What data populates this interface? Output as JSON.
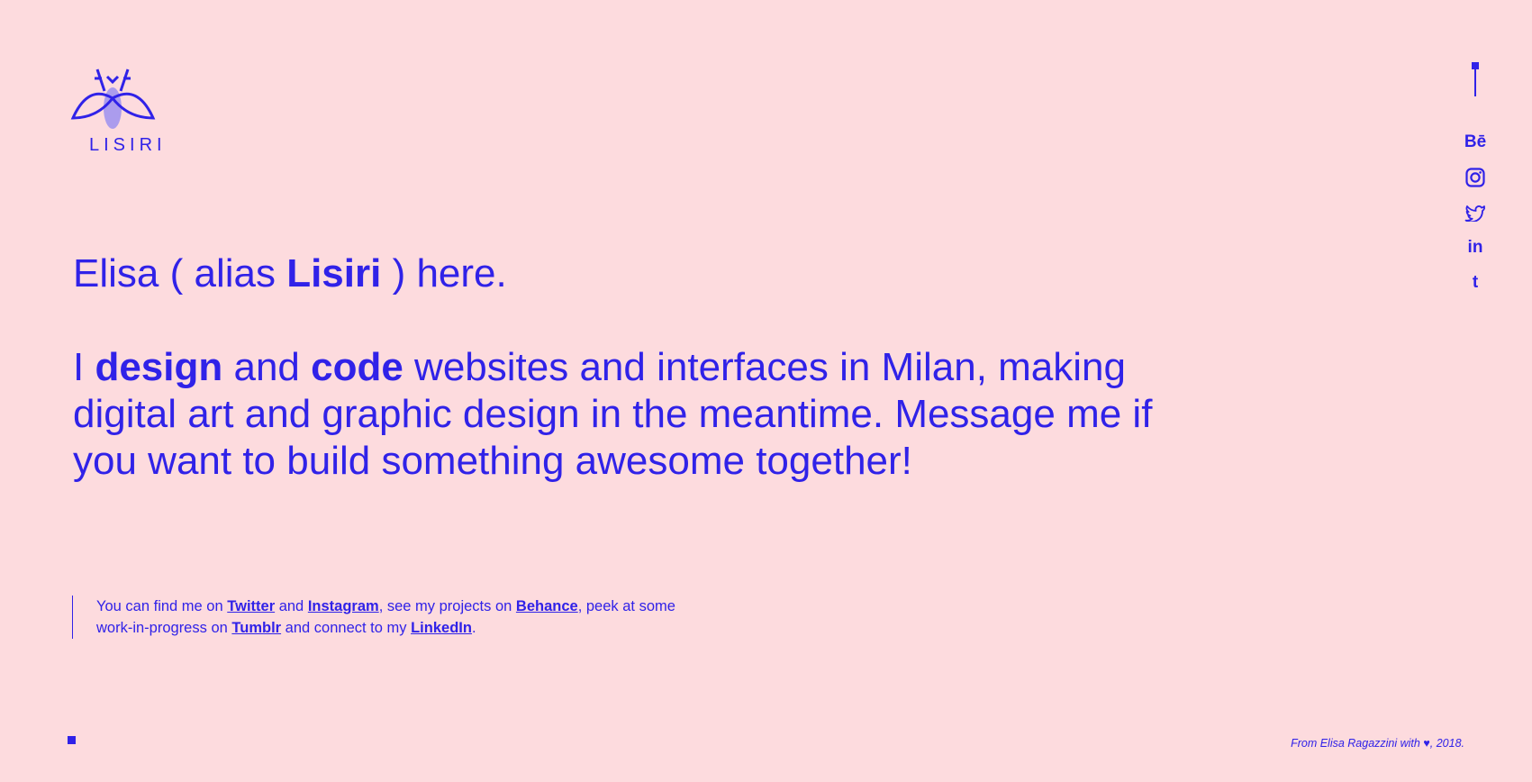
{
  "brand": {
    "name": "LISIRI"
  },
  "hero": {
    "intro": {
      "before": "Elisa ( alias ",
      "name": "Lisiri",
      "after": " ) here."
    },
    "body": {
      "w1": "I ",
      "design": "design",
      "w2": " and ",
      "code": "code",
      "w3": " websites and interfaces in Milan, making digital art and graphic design in the meantime. Message me if you want to build something awesome together!"
    }
  },
  "find": {
    "t1": "You can find me on ",
    "twitter": "Twitter",
    "t2": " and ",
    "instagram": "Instagram",
    "t3": ", see my projects on ",
    "behance": "Behance",
    "t4": ", peek at some work-in-progress on ",
    "tumblr": "Tumblr",
    "t5": " and connect to my ",
    "linkedin": "LinkedIn",
    "t6": "."
  },
  "social": {
    "behance": "Bē",
    "linkedin": "in",
    "tumblr": "t",
    "icons": [
      "behance-icon",
      "instagram-icon",
      "twitter-icon",
      "linkedin-icon",
      "tumblr-icon"
    ]
  },
  "footer": {
    "text": "From Elisa Ragazzini with",
    "heart": "♥",
    "year": ", 2018."
  },
  "colors": {
    "background": "#fddbde",
    "accent": "#3022e8"
  }
}
